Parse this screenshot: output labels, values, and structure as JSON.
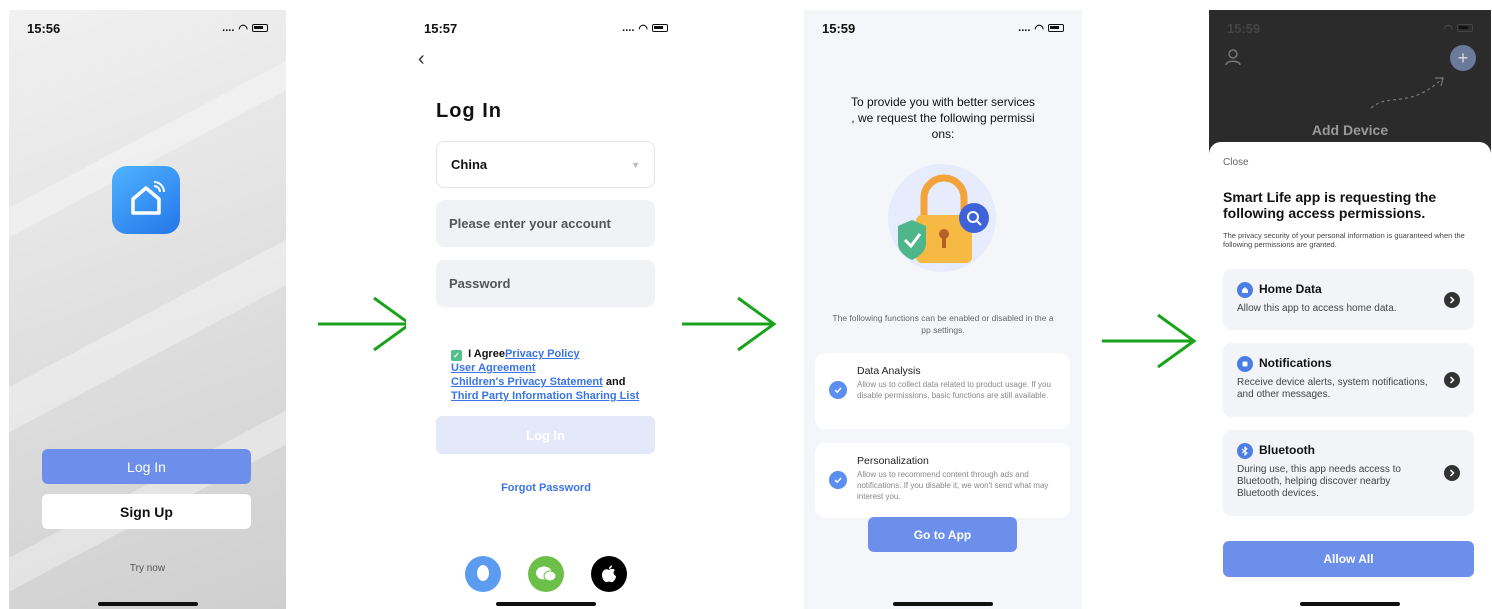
{
  "screen1": {
    "time": "15:56",
    "login_label": "Log In",
    "signup_label": "Sign Up",
    "try_label": "Try now"
  },
  "screen2": {
    "time": "15:57",
    "title": "Log In",
    "country": "China",
    "account_placeholder": "Please enter your account",
    "password_placeholder": "Password",
    "agree_text": "I Agree",
    "privacy_link": "Privacy Policy",
    "user_agreement_link": "User Agreement",
    "children_link": "Children's Privacy Statement",
    "and_text": "and",
    "third_party_link": "Third Party Information Sharing List",
    "login_button": "Log In",
    "forgot_label": "Forgot Password"
  },
  "screen3": {
    "time": "15:59",
    "heading": "To provide you with better services\n, we request the following permissi\nons:",
    "note": "The following functions can be enabled or disabled in the a\npp settings.",
    "perms": [
      {
        "title": "Data Analysis",
        "desc": "Allow us to collect data related to product usage. If you disable permissions, basic functions are still available."
      },
      {
        "title": "Personalization",
        "desc": "Allow us to recommend content through ads and notifications. If you disable it, we won't send what may interest you."
      }
    ],
    "go_label": "Go to App"
  },
  "screen4": {
    "time": "15:59",
    "add_device": "Add Device",
    "close_label": "Close",
    "title": "Smart Life app is requesting the following access permissions.",
    "subtitle": "The privacy security of your personal information is guaranteed when the following permissions are granted.",
    "items": [
      {
        "title": "Home Data",
        "desc": "Allow this app to access home data."
      },
      {
        "title": "Notifications",
        "desc": "Receive device alerts, system notifications, and other messages."
      },
      {
        "title": "Bluetooth",
        "desc": "During use, this app needs access to Bluetooth, helping discover nearby Bluetooth devices."
      }
    ],
    "allow_label": "Allow All"
  },
  "colors": {
    "accent": "#6b8fea",
    "arrow": "#1aa31a",
    "check": "#52c08a"
  }
}
